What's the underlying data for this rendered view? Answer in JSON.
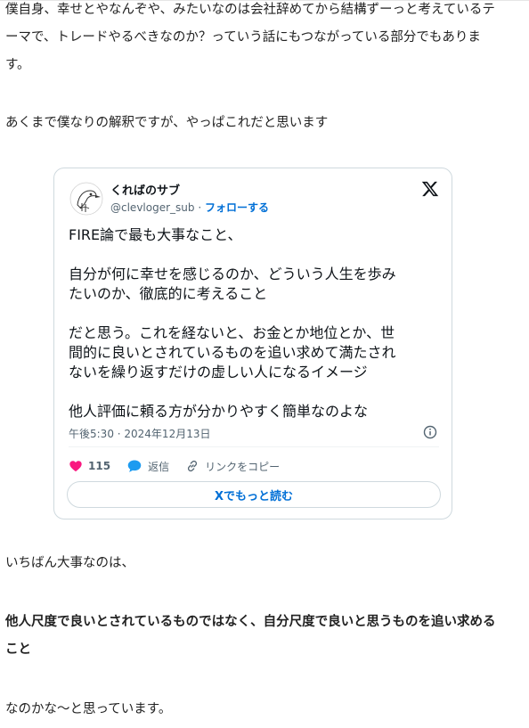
{
  "article": {
    "paragraph_1": "僕自身、幸せとやなんぞや、みたいなのは会社辞めてから結構ずーっと考えているテーマで、トレードやるべきなのか？っていう話にもつながっている部分でもあります。",
    "paragraph_2": "あくまで僕なりの解釈ですが、やっぱこれだと思います",
    "paragraph_3": "いちばん大事なのは、",
    "paragraph_4_bold": "他人尺度で良いとされているものではなく、自分尺度で良いと思うものを追い求めること",
    "paragraph_5": "なのかな～と思っています。"
  },
  "tweet": {
    "author_name": "くればのサブ",
    "handle": "@clevloger_sub",
    "separator": " · ",
    "follow_label": "フォローする",
    "text_lines": [
      "FIRE論で最も大事なこと、",
      "",
      "自分が何に幸せを感じるのか、どういう人生を歩み",
      "たいのか、徹底的に考えること",
      "",
      "だと思う。これを経ないと、お金とか地位とか、世",
      "間的に良いとされているものを追い求めて満たされ",
      "ないを繰り返すだけの虚しい人になるイメージ",
      "",
      "他人評価に頼る方が分かりやすく簡単なのよな"
    ],
    "timestamp": "午後5:30 · 2024年12月13日",
    "like_count": "115",
    "reply_label": "返信",
    "copy_link_label": "リンクをコピー",
    "read_more_label": "Xでもっと読む",
    "colors": {
      "like": "#f91880",
      "reply": "#1d9bf0",
      "link": "#006fd6",
      "muted": "#536471",
      "border": "#cfd9de"
    },
    "icons": [
      "x-logo-icon",
      "info-icon",
      "heart-icon",
      "reply-bubble-icon",
      "link-icon"
    ]
  }
}
